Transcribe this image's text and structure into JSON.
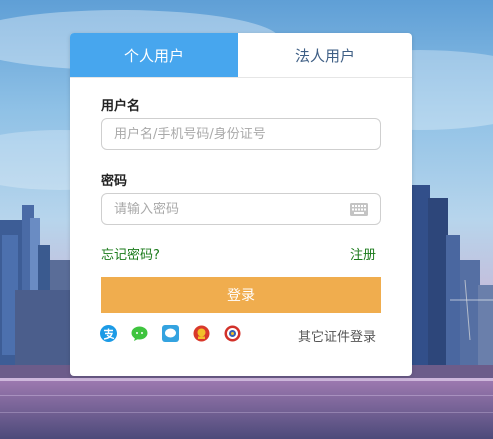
{
  "tabs": [
    {
      "label": "个人用户",
      "active": true
    },
    {
      "label": "法人用户",
      "active": false
    }
  ],
  "username": {
    "label": "用户名",
    "placeholder": "用户名/手机号码/身份证号",
    "value": ""
  },
  "password": {
    "label": "密码",
    "placeholder": "请输入密码",
    "value": ""
  },
  "links": {
    "forgot": "忘记密码?",
    "register": "注册"
  },
  "login_button": "登录",
  "alt_login": {
    "icons": [
      "alipay-icon",
      "wechat-icon",
      "chat-icon",
      "emblem-icon",
      "badge-icon"
    ],
    "other_label": "其它证件登录"
  },
  "colors": {
    "tab_active": "#47a6ee",
    "login_button": "#f0ad4e",
    "link": "#1a7a1a"
  }
}
